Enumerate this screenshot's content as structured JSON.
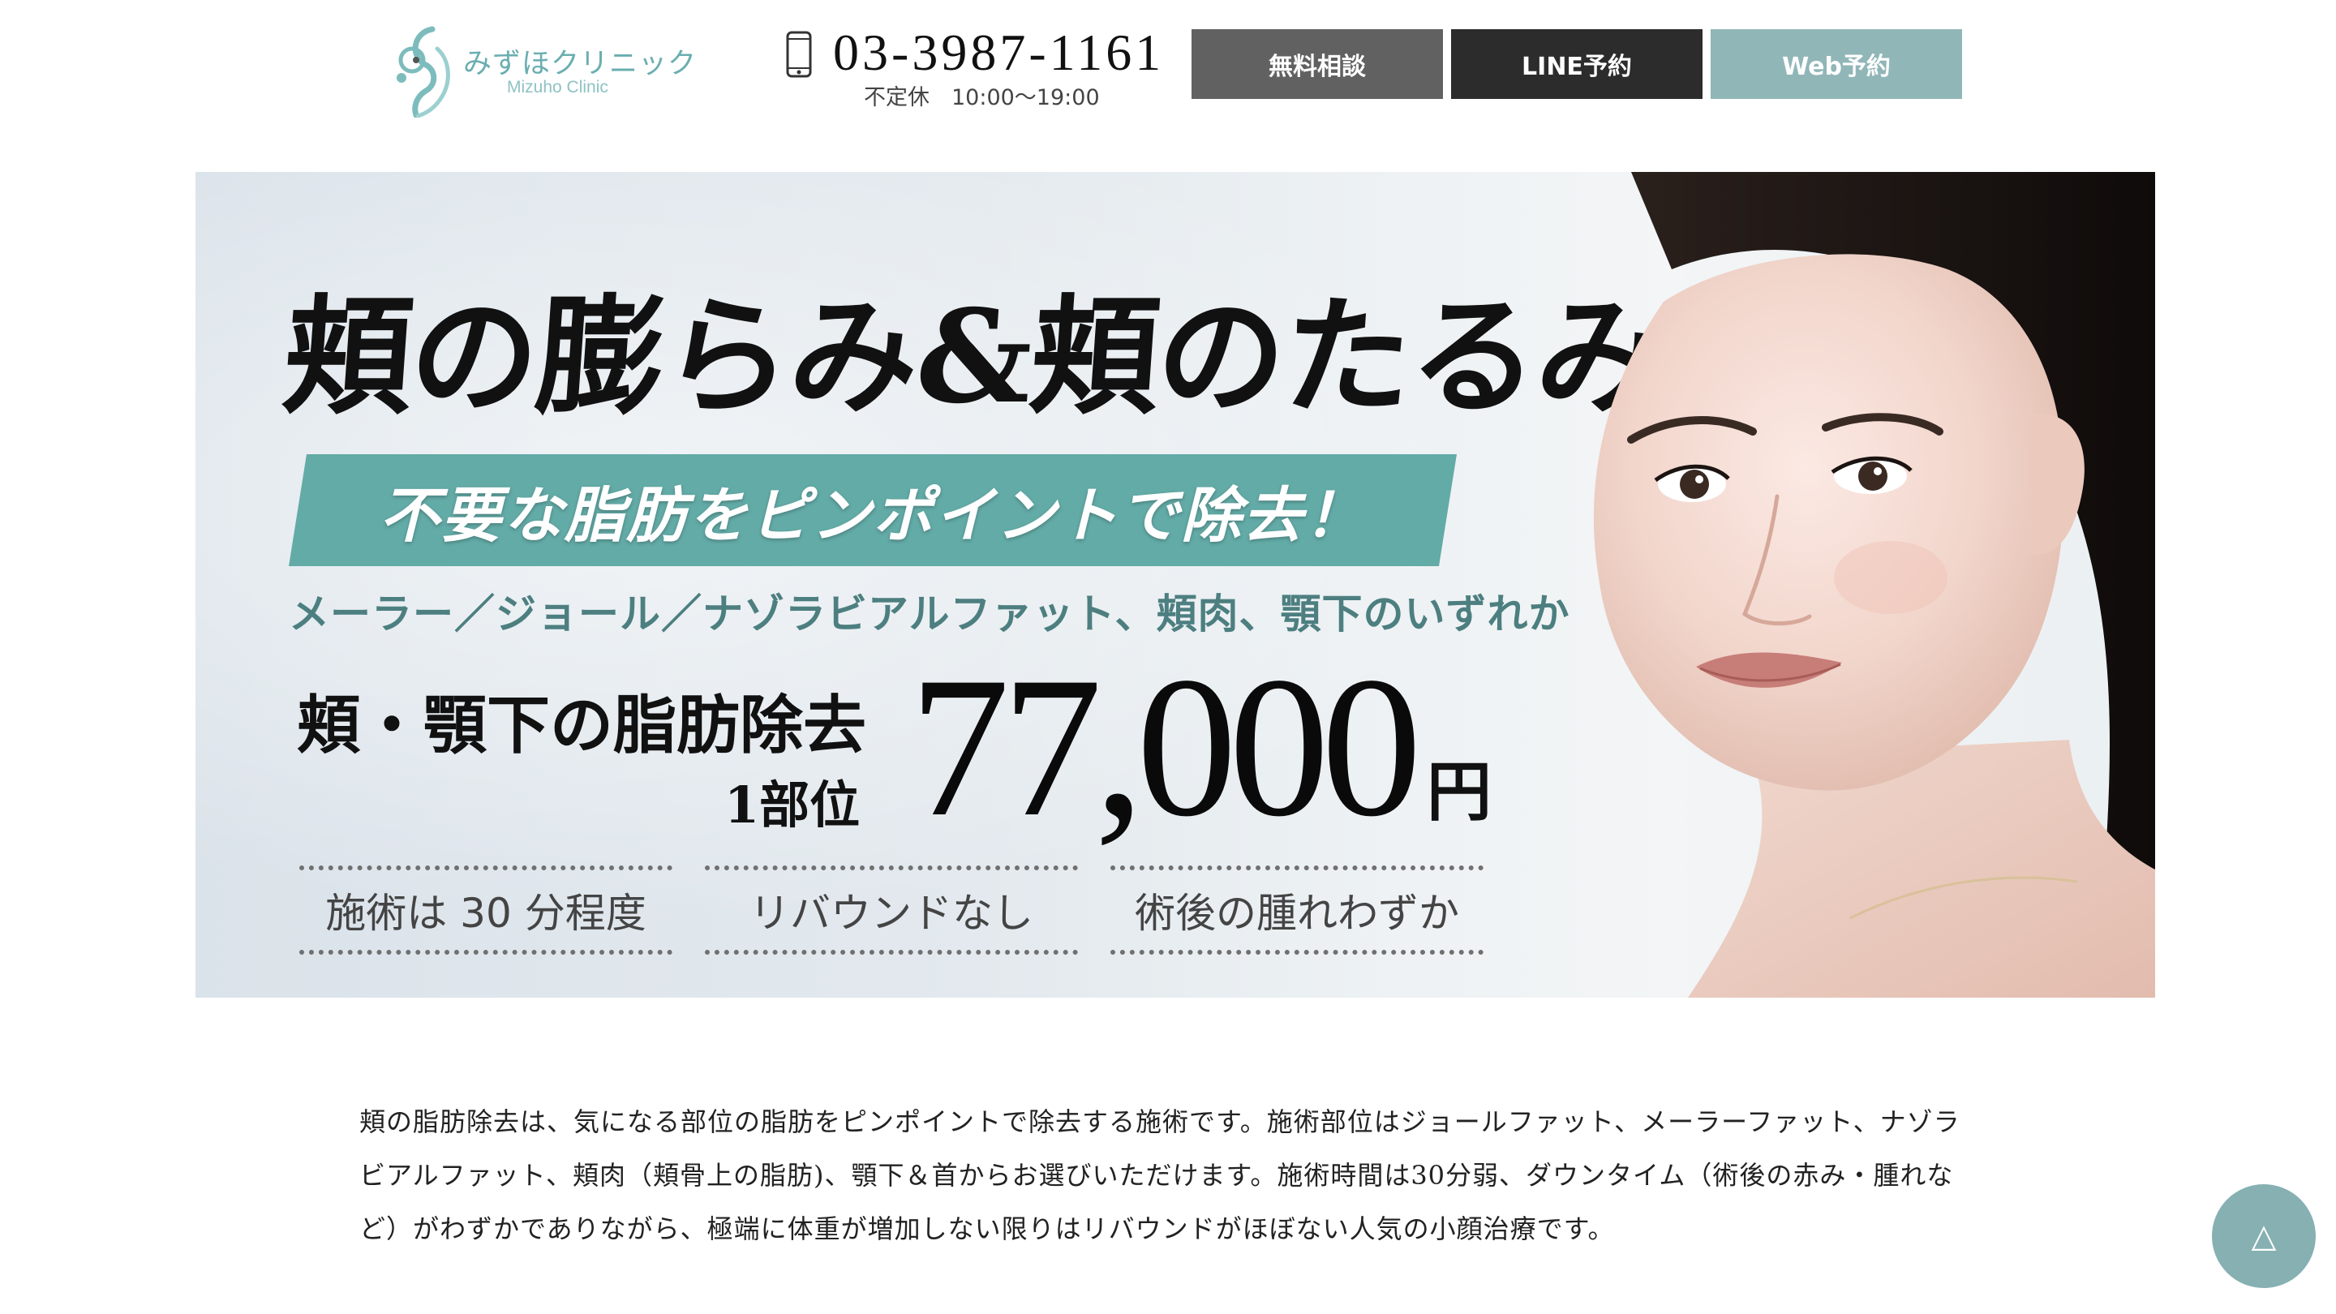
{
  "header": {
    "logo": {
      "name_ja": "みずほクリニック",
      "name_en": "Mizuho Clinic",
      "mark_icon": "clinic-logo-mark"
    },
    "phone": {
      "icon": "mobile-phone-icon",
      "number": "03-3987-1161",
      "hours": "不定休　10:00〜19:00"
    },
    "buttons": {
      "consult_label": "無料相談",
      "line_label": "LINE予約",
      "web_label": "Web予約"
    },
    "colors": {
      "consult_bg": "#616161",
      "line_bg": "#2c2c2c",
      "web_bg": "#91b6b7",
      "brand_teal": "#6aaeb0"
    }
  },
  "hero": {
    "headline": "頬の膨らみ&頬のたるみ",
    "ribbon": "不要な脂肪をピンポイントで除去！",
    "subline": "メーラー／ジョール／ナゾラビアルファット、頬肉、顎下のいずれか",
    "price_label": "頬・顎下の脂肪除去",
    "price_sub": "1部位",
    "price_value": "77,000",
    "price_unit": "円",
    "features": [
      "施術は 30 分程度",
      "リバウンドなし",
      "術後の腫れわずか"
    ],
    "ribbon_color": "#63aba7"
  },
  "description": {
    "text": "頬の脂肪除去は、気になる部位の脂肪をピンポイントで除去する施術です。施術部位はジョールファット、メーラーファット、ナゾラビアルファット、頬肉（頬骨上の脂肪)、顎下＆首からお選びいただけます。施術時間は30分弱、ダウンタイム（術後の赤み・腫れなど）がわずかでありながら、極端に体重が増加しない限りはリバウンドがほぼない人気の小顔治療です。"
  },
  "scroll_top": {
    "icon": "triangle-up-icon",
    "glyph": "△"
  }
}
